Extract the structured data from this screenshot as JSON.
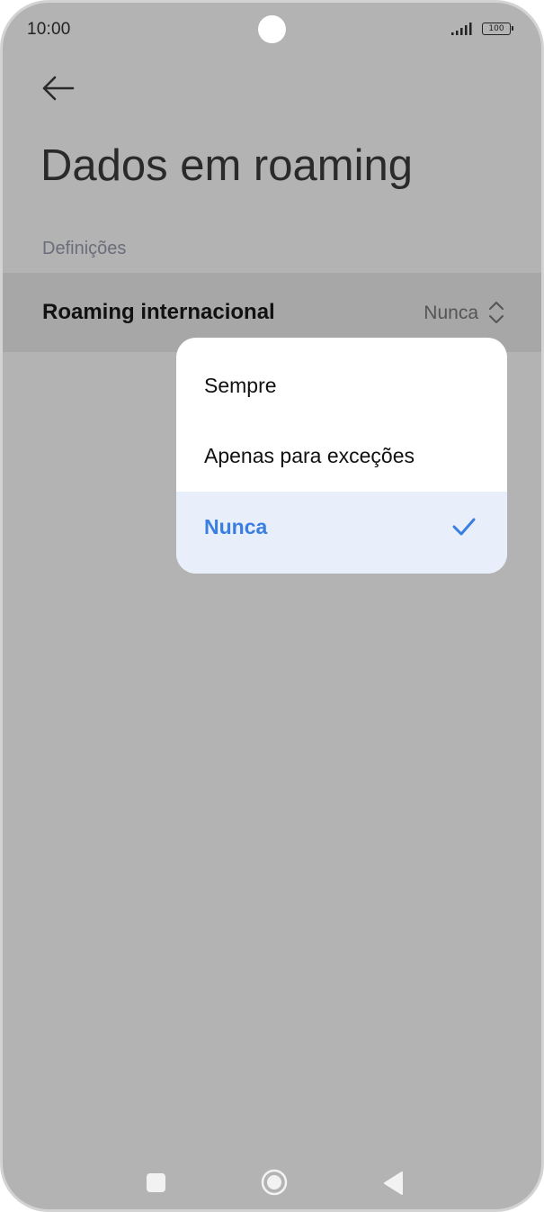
{
  "status_bar": {
    "time": "10:00",
    "battery": "100"
  },
  "header": {
    "back_icon": "arrow-left-icon",
    "title": "Dados em roaming"
  },
  "section": {
    "label": "Definições"
  },
  "setting": {
    "label": "Roaming internacional",
    "value": "Nunca",
    "icon": "chevron-up-down-icon"
  },
  "dropdown": {
    "options": [
      {
        "label": "Sempre",
        "selected": false
      },
      {
        "label": "Apenas para exceções",
        "selected": false
      },
      {
        "label": "Nunca",
        "selected": true
      }
    ],
    "check_icon": "checkmark-icon"
  },
  "colors": {
    "accent": "#3a7fe0",
    "selected_bg": "#e8effb",
    "scrim": "#b3b3b3"
  },
  "nav_bar": {
    "items": [
      "recents-square-icon",
      "home-circle-icon",
      "back-triangle-icon"
    ]
  }
}
